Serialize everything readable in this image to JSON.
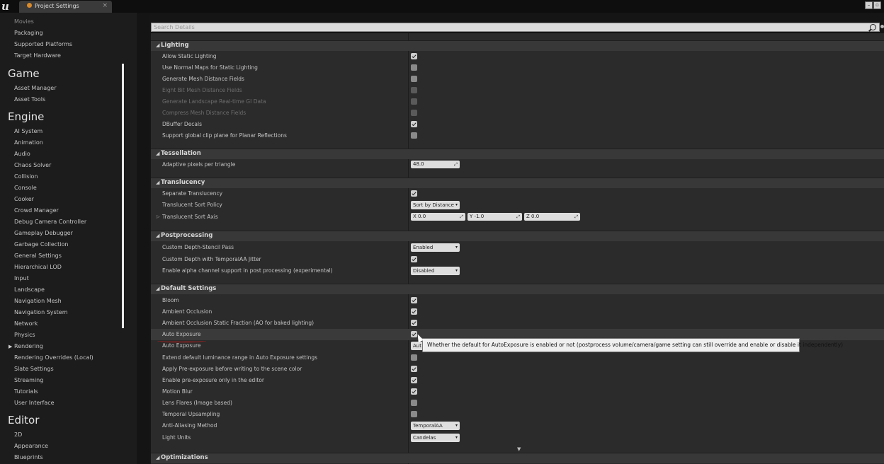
{
  "title_bar": {
    "tab_label": "Project Settings",
    "close_glyph": "×",
    "min_glyph": "–",
    "restore_glyph": "▫"
  },
  "sidebar": {
    "top_items": [
      "Movies",
      "Packaging",
      "Supported Platforms",
      "Target Hardware"
    ],
    "game_title": "Game",
    "game_items": [
      "Asset Manager",
      "Asset Tools"
    ],
    "engine_title": "Engine",
    "engine_items": [
      "AI System",
      "Animation",
      "Audio",
      "Chaos Solver",
      "Collision",
      "Console",
      "Cooker",
      "Crowd Manager",
      "Debug Camera Controller",
      "Gameplay Debugger",
      "Garbage Collection",
      "General Settings",
      "Hierarchical LOD",
      "Input",
      "Landscape",
      "Navigation Mesh",
      "Navigation System",
      "Network",
      "Physics",
      "Rendering",
      "Rendering Overrides (Local)",
      "Slate Settings",
      "Streaming",
      "Tutorials",
      "User Interface"
    ],
    "editor_title": "Editor",
    "editor_items": [
      "2D",
      "Appearance",
      "Blueprints"
    ],
    "selected": "Rendering"
  },
  "search": {
    "placeholder": "Search Details"
  },
  "sections": {
    "lighting": {
      "title": "Lighting",
      "rows": [
        {
          "label": "Allow Static Lighting",
          "checked": true,
          "disabled": false
        },
        {
          "label": "Use Normal Maps for Static Lighting",
          "checked": false,
          "disabled": false
        },
        {
          "label": "Generate Mesh Distance Fields",
          "checked": false,
          "disabled": false
        },
        {
          "label": "Eight Bit Mesh Distance Fields",
          "checked": false,
          "disabled": true
        },
        {
          "label": "Generate Landscape Real-time GI Data",
          "checked": false,
          "disabled": true
        },
        {
          "label": "Compress Mesh Distance Fields",
          "checked": false,
          "disabled": true
        },
        {
          "label": "DBuffer Decals",
          "checked": true,
          "disabled": false
        },
        {
          "label": "Support global clip plane for Planar Reflections",
          "checked": false,
          "disabled": false
        }
      ]
    },
    "tessellation": {
      "title": "Tessellation",
      "adaptive_label": "Adaptive pixels per triangle",
      "adaptive_value": "48.0"
    },
    "translucency": {
      "title": "Translucency",
      "separate_label": "Separate Translucency",
      "separate_checked": true,
      "sort_policy_label": "Translucent Sort Policy",
      "sort_policy_value": "Sort by Distance",
      "sort_axis_label": "Translucent Sort Axis",
      "axis_x": "X  0.0",
      "axis_y": "Y  -1.0",
      "axis_z": "Z  0.0"
    },
    "postprocessing": {
      "title": "Postprocessing",
      "stencil_label": "Custom Depth-Stencil Pass",
      "stencil_value": "Enabled",
      "jitter_label": "Custom Depth with TemporalAA Jitter",
      "jitter_checked": true,
      "alpha_label": "Enable alpha channel support in post processing (experimental)",
      "alpha_value": "Disabled"
    },
    "default_settings": {
      "title": "Default Settings",
      "rows": [
        {
          "label": "Bloom",
          "type": "checkbox",
          "checked": true
        },
        {
          "label": "Ambient Occlusion",
          "type": "checkbox",
          "checked": true
        },
        {
          "label": "Ambient Occlusion Static Fraction (AO for baked lighting)",
          "type": "checkbox",
          "checked": true
        },
        {
          "label": "Auto Exposure",
          "type": "checkbox",
          "checked": true
        },
        {
          "label": "Auto Exposure",
          "type": "dropdown",
          "value": "Aut"
        },
        {
          "label": "Extend default luminance range in Auto Exposure settings",
          "type": "checkbox",
          "checked": false
        },
        {
          "label": "Apply Pre-exposure before writing to the scene color",
          "type": "checkbox",
          "checked": true
        },
        {
          "label": "Enable pre-exposure only in the editor",
          "type": "checkbox",
          "checked": true
        },
        {
          "label": "Motion Blur",
          "type": "checkbox",
          "checked": true
        },
        {
          "label": "Lens Flares (Image based)",
          "type": "checkbox",
          "checked": false
        },
        {
          "label": "Temporal Upsampling",
          "type": "checkbox",
          "checked": false
        },
        {
          "label": "Anti-Aliasing Method",
          "type": "dropdown",
          "value": "TemporalAA"
        },
        {
          "label": "Light Units",
          "type": "dropdown",
          "value": "Candelas"
        }
      ]
    },
    "optimizations": {
      "title": "Optimizations"
    }
  },
  "tooltip": "Whether the default for AutoExposure is enabled or not (postprocess volume/camera/game setting can still override and enable or disable it independently)",
  "icons": {
    "logo": "u",
    "triangle_down": "◢",
    "triangle_right": "▷",
    "caret": "▾",
    "spin": "⤢",
    "more": "▼",
    "selected_arrow": "▶"
  },
  "colors": {
    "annotation_underline": "#d41c1c",
    "tab_icon": "#d98a2a"
  }
}
